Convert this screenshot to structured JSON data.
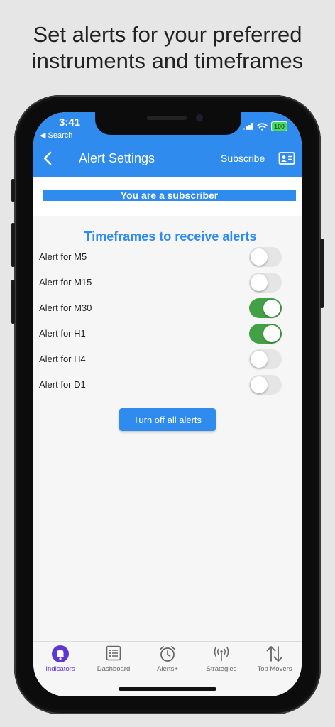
{
  "promo": {
    "line1": "Set alerts for your preferred",
    "line2": "instruments and timeframes"
  },
  "status": {
    "time": "3:41",
    "back_app": "◀ Search",
    "battery": "100"
  },
  "nav": {
    "title": "Alert Settings",
    "subscribe": "Subscribe",
    "back_icon": "chevron-left-icon",
    "card_icon": "id-card-icon"
  },
  "subscriber_banner": "You are a subscriber",
  "timeframes": {
    "title": "Timeframes to receive alerts",
    "items": [
      {
        "label": "Alert for M5",
        "on": false
      },
      {
        "label": "Alert for M15",
        "on": false
      },
      {
        "label": "Alert for M30",
        "on": true
      },
      {
        "label": "Alert for H1",
        "on": true
      },
      {
        "label": "Alert for H4",
        "on": false
      },
      {
        "label": "Alert for D1",
        "on": false
      }
    ]
  },
  "turn_off_label": "Turn off all alerts",
  "tabs": [
    {
      "label": "Indicators",
      "icon": "bell-icon",
      "active": true
    },
    {
      "label": "Dashboard",
      "icon": "list-icon",
      "active": false
    },
    {
      "label": "Alerts+",
      "icon": "alarm-clock-icon",
      "active": false
    },
    {
      "label": "Strategies",
      "icon": "broadcast-icon",
      "active": false
    },
    {
      "label": "Top Movers",
      "icon": "arrows-up-down-icon",
      "active": false
    }
  ],
  "colors": {
    "accent": "#2f8bed",
    "toggle_on": "#43a047",
    "active_tab": "#5e35d6"
  }
}
